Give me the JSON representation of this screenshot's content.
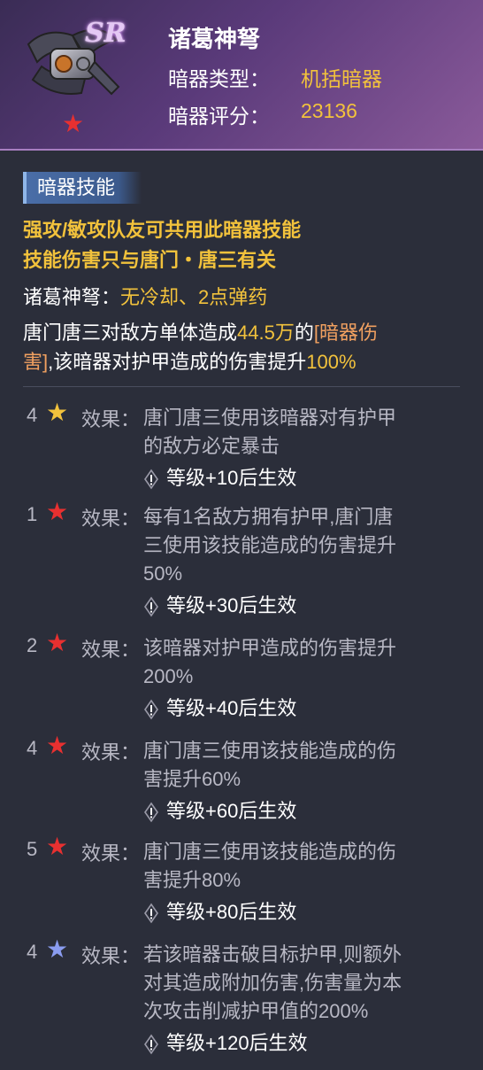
{
  "header": {
    "rarity": "SR",
    "name": "诸葛神弩",
    "type_label": "暗器类型：",
    "type_value": "机括暗器",
    "score_label": "暗器评分：",
    "score_value": "23136"
  },
  "skill": {
    "tag": "暗器技能",
    "shared_line1": "强攻/敏攻队友可共用此暗器技能",
    "shared_line2": "技能伤害只与唐门・唐三有关",
    "ammo_name": "诸葛神弩：",
    "ammo_value": "无冷却、2点弹药",
    "desc_part1": "唐门唐三对敌方单体造成",
    "desc_damage": "44.5万",
    "desc_part2": "的",
    "desc_tag_a": "[暗器伤",
    "desc_tag_b": "害]",
    "desc_part3": ",该暗器对护甲造成的伤害提升",
    "desc_pct": "100%"
  },
  "effects": [
    {
      "num": "4",
      "star": "gold",
      "label": "效果：",
      "lines": [
        "唐门唐三使用该暗器对有护甲",
        "的敌方必定暴击"
      ],
      "req": "等级+10后生效"
    },
    {
      "num": "1",
      "star": "red",
      "label": "效果：",
      "lines": [
        "每有1名敌方拥有护甲,唐门唐",
        "三使用该技能造成的伤害提升",
        "50%"
      ],
      "req": "等级+30后生效"
    },
    {
      "num": "2",
      "star": "red",
      "label": "效果：",
      "lines": [
        "该暗器对护甲造成的伤害提升",
        "200%"
      ],
      "req": "等级+40后生效"
    },
    {
      "num": "4",
      "star": "red",
      "label": "效果：",
      "lines": [
        "唐门唐三使用该技能造成的伤",
        "害提升60%"
      ],
      "req": "等级+60后生效"
    },
    {
      "num": "5",
      "star": "red",
      "label": "效果：",
      "lines": [
        "唐门唐三使用该技能造成的伤",
        "害提升80%"
      ],
      "req": "等级+80后生效"
    },
    {
      "num": "4",
      "star": "blue",
      "label": "效果：",
      "lines": [
        "若该暗器击破目标护甲,则额外",
        "对其造成附加伤害,伤害量为本",
        "次攻击削减护甲值的200%"
      ],
      "req": "等级+120后生效"
    }
  ],
  "colors": {
    "gold": "#f2c23c",
    "red": "#e83030",
    "blue": "#8a9cf0"
  }
}
